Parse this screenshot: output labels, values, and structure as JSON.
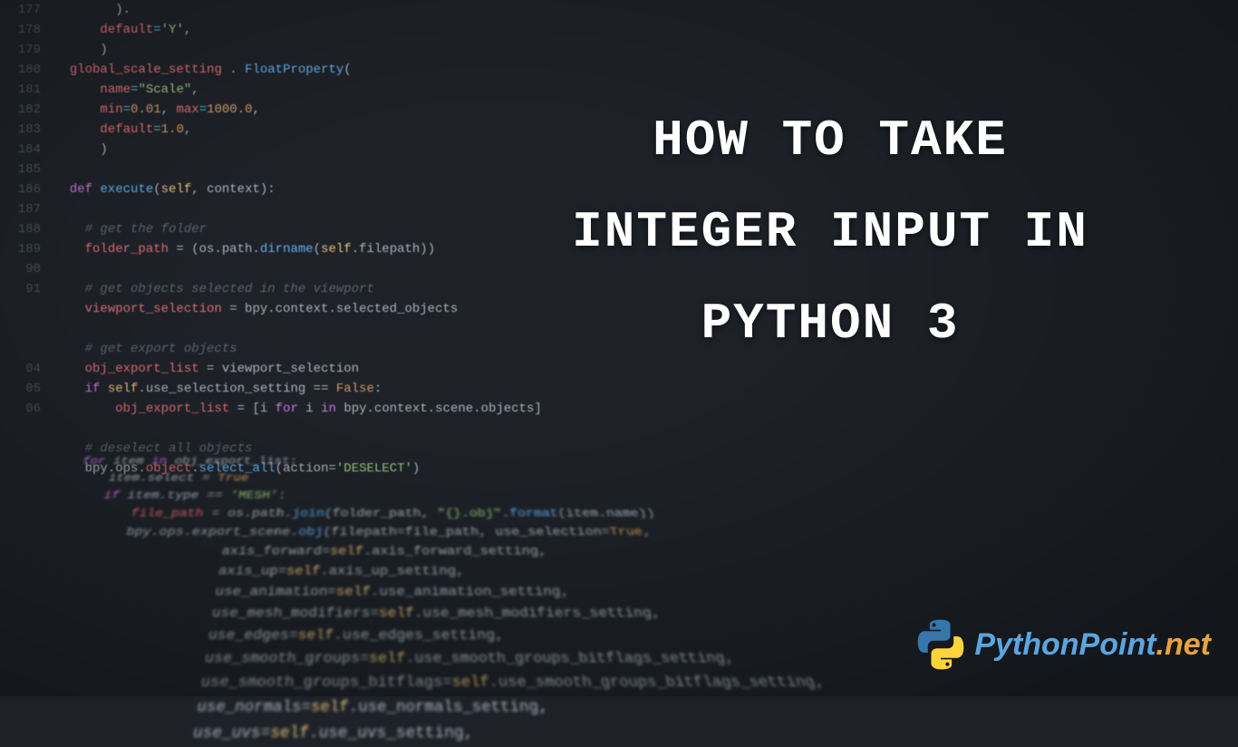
{
  "title_line1": "HOW TO TAKE",
  "title_line2": "INTEGER INPUT IN",
  "title_line3": "PYTHON 3",
  "logo_text": "PythonPoint",
  "logo_tld": ".net",
  "gutter_lines": [
    "177",
    "178",
    "179",
    "180",
    "181",
    "182",
    "183",
    "184",
    "185",
    "186",
    "187",
    "188",
    "189",
    "90",
    "91",
    "",
    "",
    "",
    "04",
    "05",
    "06",
    "",
    "",
    "",
    ""
  ],
  "code_lines": [
    {
      "i": 8,
      "c": "p",
      "t": ")."
    },
    {
      "i": 6,
      "spans": [
        {
          "c": "var",
          "t": "default"
        },
        {
          "c": "op",
          "t": "="
        },
        {
          "c": "str",
          "t": "'Y'"
        },
        {
          "c": "p",
          "t": ","
        }
      ]
    },
    {
      "i": 6,
      "c": "p",
      "t": ")"
    },
    {
      "i": 2,
      "spans": [
        {
          "c": "var",
          "t": "global_scale_setting"
        },
        {
          "c": "p",
          "t": " . "
        },
        {
          "c": "fn",
          "t": "FloatProperty"
        },
        {
          "c": "p",
          "t": "("
        }
      ]
    },
    {
      "i": 6,
      "spans": [
        {
          "c": "var",
          "t": "name"
        },
        {
          "c": "op",
          "t": "="
        },
        {
          "c": "str",
          "t": "\"Scale\""
        },
        {
          "c": "p",
          "t": ","
        }
      ]
    },
    {
      "i": 6,
      "spans": [
        {
          "c": "var",
          "t": "min"
        },
        {
          "c": "op",
          "t": "="
        },
        {
          "c": "num",
          "t": "0.01"
        },
        {
          "c": "p",
          "t": ", "
        },
        {
          "c": "var",
          "t": "max"
        },
        {
          "c": "op",
          "t": "="
        },
        {
          "c": "num",
          "t": "1000.0"
        },
        {
          "c": "p",
          "t": ","
        }
      ]
    },
    {
      "i": 6,
      "spans": [
        {
          "c": "var",
          "t": "default"
        },
        {
          "c": "op",
          "t": "="
        },
        {
          "c": "num",
          "t": "1.0"
        },
        {
          "c": "p",
          "t": ","
        }
      ]
    },
    {
      "i": 6,
      "c": "p",
      "t": ")"
    },
    {
      "i": 0,
      "c": "p",
      "t": ""
    },
    {
      "i": 2,
      "spans": [
        {
          "c": "kw",
          "t": "def"
        },
        {
          "c": "p",
          "t": " "
        },
        {
          "c": "fn",
          "t": "execute"
        },
        {
          "c": "p",
          "t": "("
        },
        {
          "c": "self",
          "t": "self"
        },
        {
          "c": "p",
          "t": ", context):"
        }
      ]
    },
    {
      "i": 0,
      "c": "p",
      "t": ""
    },
    {
      "i": 4,
      "c": "cmt",
      "t": "# get the folder"
    },
    {
      "i": 4,
      "spans": [
        {
          "c": "var",
          "t": "folder_path"
        },
        {
          "c": "p",
          "t": " = (os.path."
        },
        {
          "c": "fn",
          "t": "dirname"
        },
        {
          "c": "p",
          "t": "("
        },
        {
          "c": "self",
          "t": "self"
        },
        {
          "c": "p",
          "t": ".filepath))"
        }
      ]
    },
    {
      "i": 0,
      "c": "p",
      "t": ""
    },
    {
      "i": 4,
      "c": "cmt",
      "t": "# get objects selected in the viewport"
    },
    {
      "i": 4,
      "spans": [
        {
          "c": "var",
          "t": "viewport_selection"
        },
        {
          "c": "p",
          "t": " = bpy.context.selected_objects"
        }
      ]
    },
    {
      "i": 0,
      "c": "p",
      "t": ""
    },
    {
      "i": 4,
      "c": "cmt",
      "t": "# get export objects"
    },
    {
      "i": 4,
      "spans": [
        {
          "c": "var",
          "t": "obj_export_list"
        },
        {
          "c": "p",
          "t": " = viewport_selection"
        }
      ]
    },
    {
      "i": 4,
      "spans": [
        {
          "c": "kw",
          "t": "if"
        },
        {
          "c": "p",
          "t": " "
        },
        {
          "c": "self",
          "t": "self"
        },
        {
          "c": "p",
          "t": ".use_selection_setting == "
        },
        {
          "c": "bool",
          "t": "False"
        },
        {
          "c": "p",
          "t": ":"
        }
      ]
    },
    {
      "i": 8,
      "spans": [
        {
          "c": "var",
          "t": "obj_export_list"
        },
        {
          "c": "p",
          "t": " = [i "
        },
        {
          "c": "kw",
          "t": "for"
        },
        {
          "c": "p",
          "t": " i "
        },
        {
          "c": "kw",
          "t": "in"
        },
        {
          "c": "p",
          "t": " bpy.context.scene.objects]"
        }
      ]
    },
    {
      "i": 0,
      "c": "p",
      "t": ""
    },
    {
      "i": 4,
      "c": "cmt",
      "t": "# deselect all objects"
    },
    {
      "i": 4,
      "spans": [
        {
          "c": "p",
          "t": "bpy.ops."
        },
        {
          "c": "var",
          "t": "object"
        },
        {
          "c": "p",
          "t": "."
        },
        {
          "c": "fn",
          "t": "select_all"
        },
        {
          "c": "p",
          "t": "(action="
        },
        {
          "c": "str",
          "t": "'DESELECT'"
        },
        {
          "c": "p",
          "t": ")"
        }
      ]
    },
    {
      "i": 0,
      "c": "p",
      "t": ""
    }
  ],
  "pers_lines": [
    {
      "i": 4,
      "spans": [
        {
          "c": "kw",
          "t": "for"
        },
        {
          "c": "p",
          "t": " item "
        },
        {
          "c": "kw",
          "t": "in"
        },
        {
          "c": "p",
          "t": " obj_export_list:"
        }
      ]
    },
    {
      "i": 8,
      "spans": [
        {
          "c": "p",
          "t": "item.select = "
        },
        {
          "c": "bool",
          "t": "True"
        }
      ]
    },
    {
      "i": 8,
      "spans": [
        {
          "c": "kw",
          "t": "if"
        },
        {
          "c": "p",
          "t": " item.type == "
        },
        {
          "c": "str",
          "t": "'MESH'"
        },
        {
          "c": "p",
          "t": ":"
        }
      ]
    },
    {
      "i": 12,
      "spans": [
        {
          "c": "var",
          "t": "file_path"
        },
        {
          "c": "p",
          "t": " = os.path."
        },
        {
          "c": "fn",
          "t": "join"
        },
        {
          "c": "p",
          "t": "(folder_path, "
        },
        {
          "c": "str",
          "t": "\"{}.obj\""
        },
        {
          "c": "p",
          "t": "."
        },
        {
          "c": "fn",
          "t": "format"
        },
        {
          "c": "p",
          "t": "(item.name))"
        }
      ]
    },
    {
      "i": 12,
      "spans": [
        {
          "c": "p",
          "t": "bpy.ops.export_scene."
        },
        {
          "c": "fn",
          "t": "obj"
        },
        {
          "c": "p",
          "t": "(filepath=file_path, use_selection="
        },
        {
          "c": "bool",
          "t": "True"
        },
        {
          "c": "p",
          "t": ","
        }
      ]
    },
    {
      "i": 24,
      "spans": [
        {
          "c": "p",
          "t": "axis_forward="
        },
        {
          "c": "self",
          "t": "self"
        },
        {
          "c": "p",
          "t": ".axis_forward_setting,"
        }
      ]
    },
    {
      "i": 24,
      "spans": [
        {
          "c": "p",
          "t": "axis_up="
        },
        {
          "c": "self",
          "t": "self"
        },
        {
          "c": "p",
          "t": ".axis_up_setting,"
        }
      ]
    },
    {
      "i": 24,
      "spans": [
        {
          "c": "p",
          "t": "use_animation="
        },
        {
          "c": "self",
          "t": "self"
        },
        {
          "c": "p",
          "t": ".use_animation_setting,"
        }
      ]
    },
    {
      "i": 24,
      "spans": [
        {
          "c": "p",
          "t": "use_mesh_modifiers="
        },
        {
          "c": "self",
          "t": "self"
        },
        {
          "c": "p",
          "t": ".use_mesh_modifiers_setting,"
        }
      ]
    },
    {
      "i": 24,
      "spans": [
        {
          "c": "p",
          "t": "use_edges="
        },
        {
          "c": "self",
          "t": "self"
        },
        {
          "c": "p",
          "t": ".use_edges_setting,"
        }
      ]
    },
    {
      "i": 24,
      "spans": [
        {
          "c": "p",
          "t": "use_smooth_groups="
        },
        {
          "c": "self",
          "t": "self"
        },
        {
          "c": "p",
          "t": ".use_smooth_groups_bitflags_setting,"
        }
      ]
    },
    {
      "i": 24,
      "spans": [
        {
          "c": "p",
          "t": "use_smooth_groups_bitflags="
        },
        {
          "c": "self",
          "t": "self"
        },
        {
          "c": "p",
          "t": ".use_smooth_groups_bitflags_setting,"
        }
      ]
    },
    {
      "i": 24,
      "spans": [
        {
          "c": "p",
          "t": "use_normals="
        },
        {
          "c": "self",
          "t": "self"
        },
        {
          "c": "p",
          "t": ".use_normals_setting,"
        }
      ]
    },
    {
      "i": 24,
      "spans": [
        {
          "c": "p",
          "t": "use_uvs="
        },
        {
          "c": "self",
          "t": "self"
        },
        {
          "c": "p",
          "t": ".use_uvs_setting,"
        }
      ]
    }
  ]
}
